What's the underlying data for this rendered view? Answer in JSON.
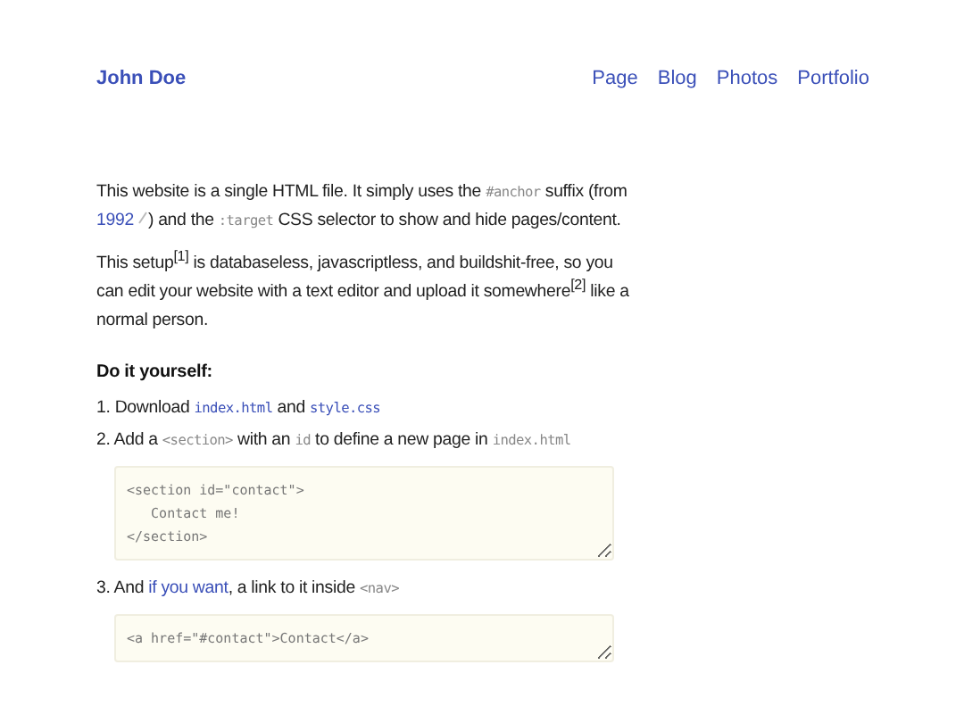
{
  "header": {
    "title": "John Doe",
    "nav": [
      "Page",
      "Blog",
      "Photos",
      "Portfolio"
    ]
  },
  "paragraphs": [
    [
      {
        "kind": "text",
        "text": "This website is a single HTML file. It simply uses the "
      },
      {
        "kind": "code",
        "text": "#anchor"
      },
      {
        "kind": "text",
        "text": " suffix (from "
      },
      {
        "kind": "extlink",
        "text": "1992"
      },
      {
        "kind": "text",
        "text": ") and the "
      },
      {
        "kind": "code",
        "text": ":target"
      },
      {
        "kind": "text",
        "text": " CSS selector to show and hide pages/content."
      }
    ],
    [
      {
        "kind": "text",
        "text": "This setup$^{[1]}$ is databaseless, javascriptless, and buildshit-free, so you can edit your website with a text editor and upload it somewhere$^{[2]}$ like a normal person."
      }
    ]
  ],
  "heading": "Do it yourself:",
  "steps": [
    {
      "number": "1.",
      "parts": [
        {
          "kind": "text",
          "text": "Download "
        },
        {
          "kind": "codelink",
          "text": "index.html"
        },
        {
          "kind": "text",
          "text": " and "
        },
        {
          "kind": "codelink",
          "text": "style.css"
        }
      ]
    },
    {
      "number": "2.",
      "parts": [
        {
          "kind": "text",
          "text": "Add a "
        },
        {
          "kind": "code",
          "text": "<section>"
        },
        {
          "kind": "text",
          "text": " with an "
        },
        {
          "kind": "code",
          "text": "id"
        },
        {
          "kind": "text",
          "text": " to define a new page in "
        },
        {
          "kind": "code",
          "text": "index.html"
        }
      ],
      "snippet": "<section id=\"contact\">\n   Contact me!\n</section>"
    },
    {
      "number": "3.",
      "parts": [
        {
          "kind": "text",
          "text": "And "
        },
        {
          "kind": "link",
          "text": "if you want"
        },
        {
          "kind": "text",
          "text": ", a link to it inside "
        },
        {
          "kind": "code",
          "text": "<nav>"
        }
      ],
      "snippet": "<a href=\"#contact\">Contact</a>"
    }
  ]
}
